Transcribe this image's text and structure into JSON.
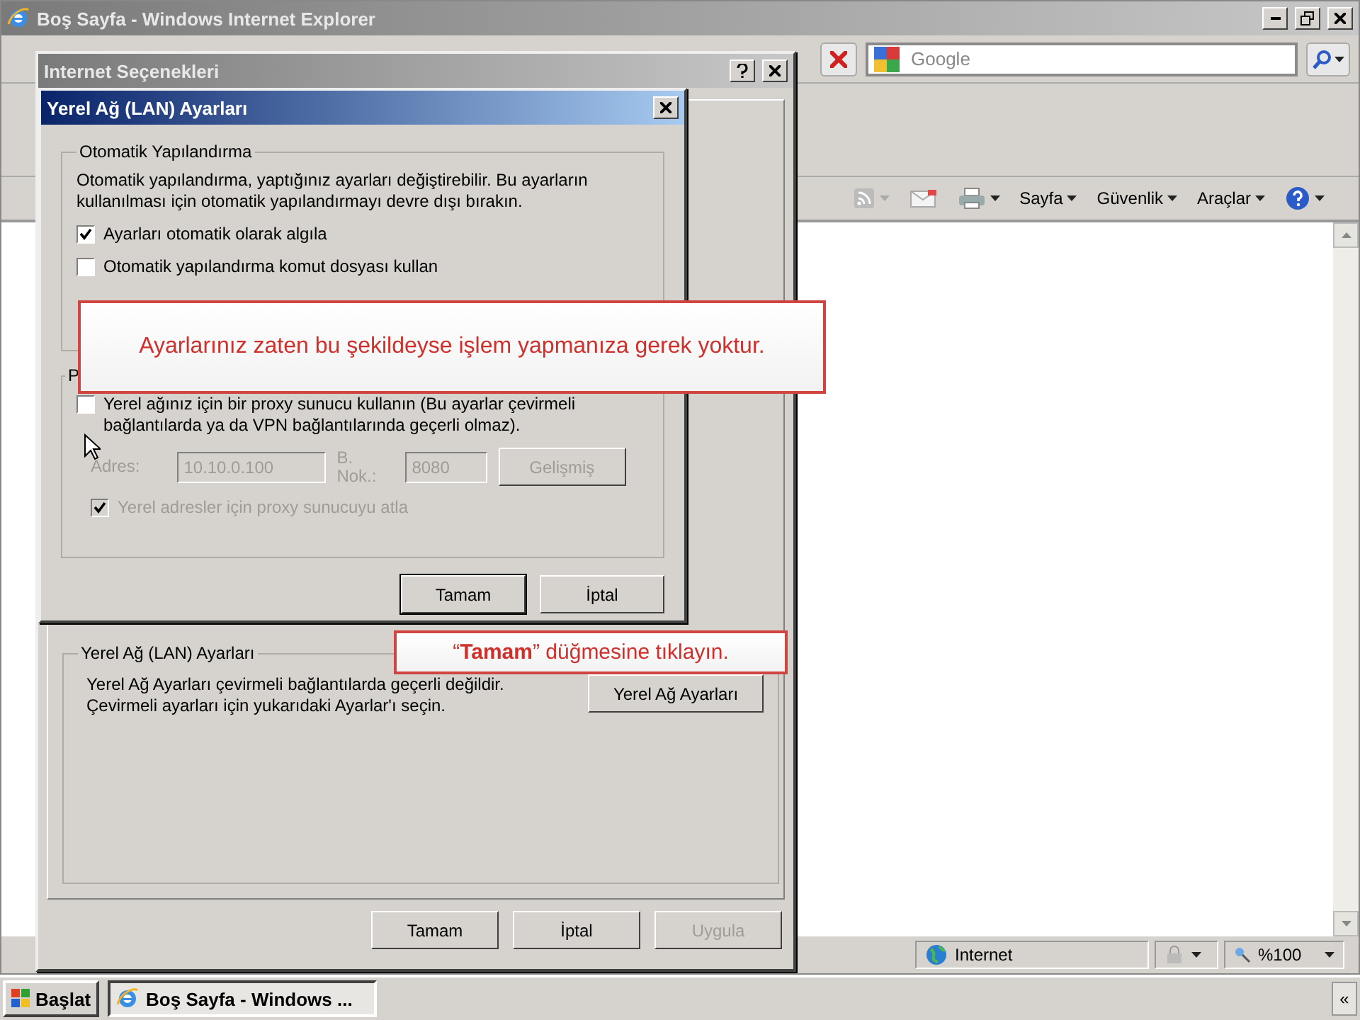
{
  "browser": {
    "title": "Boş Sayfa - Windows Internet Explorer",
    "search": {
      "placeholder": "Google"
    },
    "command_bar": [
      {
        "kind": "feed"
      },
      {
        "kind": "mail"
      },
      {
        "kind": "print"
      },
      {
        "kind": "menu",
        "label": "Sayfa"
      },
      {
        "kind": "menu",
        "label": "Güvenlik"
      },
      {
        "kind": "menu",
        "label": "Araçlar"
      },
      {
        "kind": "help"
      }
    ],
    "status_bar": {
      "zone": "Internet",
      "zoom": "%100"
    }
  },
  "options_dialog": {
    "title": "Internet Seçenekleri",
    "lan_group": {
      "legend": "Yerel Ağ (LAN) Ayarları",
      "text": "Yerel Ağ Ayarları çevirmeli bağlantılarda geçerli değildir. Çevirmeli ayarları için yukarıdaki Ayarlar'ı seçin.",
      "button": "Yerel Ağ Ayarları"
    },
    "buttons": [
      {
        "label": "Tamam",
        "disabled": false
      },
      {
        "label": "İptal",
        "disabled": false
      },
      {
        "label": "Uygula",
        "disabled": true
      }
    ]
  },
  "lan_dialog": {
    "title": "Yerel Ağ (LAN) Ayarları",
    "auto_group": {
      "legend": "Otomatik Yapılandırma",
      "text": "Otomatik yapılandırma, yaptığınız ayarları değiştirebilir. Bu ayarların kullanılması için otomatik yapılandırmayı devre dışı bırakın.",
      "options": [
        {
          "label": "Ayarları otomatik olarak algıla",
          "checked": true,
          "disabled": false
        },
        {
          "label": "Otomatik yapılandırma komut dosyası kullan",
          "checked": false,
          "disabled": false
        }
      ]
    },
    "proxy_group": {
      "legend": "P",
      "use_proxy": {
        "label": "Yerel ağınız için bir proxy sunucu kullanın (Bu ayarlar çevirmeli bağlantılarda ya da VPN bağlantılarında geçerli olmaz).",
        "checked": false,
        "disabled": false
      },
      "address_label": "Adres:",
      "address": "10.10.0.100",
      "port_label": "B. Nok.:",
      "port": "8080",
      "advanced_button": "Gelişmiş",
      "bypass": {
        "label": "Yerel adresler için proxy sunucuyu atla",
        "checked": true,
        "disabled": true
      }
    },
    "buttons": [
      {
        "label": "Tamam",
        "default": true
      },
      {
        "label": "İptal",
        "default": false
      }
    ]
  },
  "callouts": [
    {
      "text": "Ayarlarınız zaten bu şekildeyse işlem yapmanıza gerek yoktur."
    },
    {
      "text": "“**Tamam**” düğmesine tıklayın."
    }
  ],
  "taskbar": {
    "start": "Başlat",
    "tasks": [
      {
        "label": "Boş Sayfa - Windows ...",
        "selected": true
      }
    ],
    "tray_toggle": "«"
  }
}
